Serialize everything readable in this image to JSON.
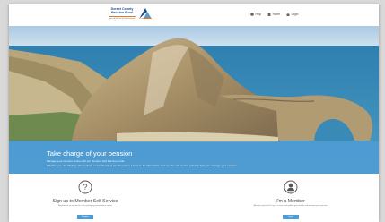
{
  "header": {
    "logo_line1": "Dorset County",
    "logo_line2": "Pension Fund",
    "logo_tagline": "part of the Local Government Pension Scheme",
    "nav": [
      {
        "label": "Help",
        "icon": "help-icon"
      },
      {
        "label": "Home",
        "icon": "home-icon"
      },
      {
        "label": "Login",
        "icon": "login-icon"
      }
    ]
  },
  "hero": {
    "title": "Take charge of your pension",
    "line1": "Manage your pension online with our Member Self Service portal.",
    "line2": "Whether you are thinking about joining or are already a member, have a browse for information and use the self service portal to help you manage your pension.",
    "band_color": "#4f9cd6"
  },
  "cards": [
    {
      "title": "Sign up to Member Self Service",
      "desc": "Register for an account to start managing your pension online.",
      "button": "Register",
      "icon": "question-circle-icon"
    },
    {
      "title": "I'm a Member",
      "desc": "Already registered? Log in to view and update your details and manage your pension.",
      "button": "Log in",
      "icon": "user-circle-icon"
    }
  ],
  "colors": {
    "accent": "#4f9cd6",
    "logo_blue": "#1f4d8a",
    "logo_orange": "#e07a22"
  }
}
